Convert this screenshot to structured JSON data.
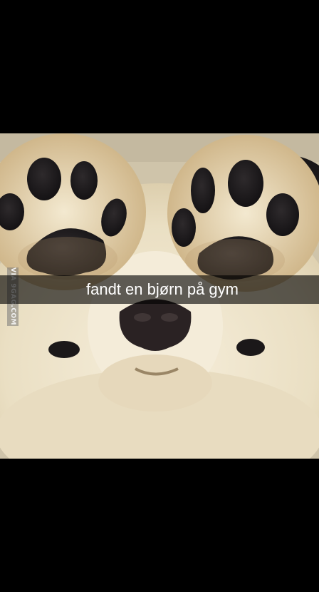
{
  "snap": {
    "caption": "fandt en bjørn på gym",
    "watermark": "VIA 9GAG.COM"
  },
  "image": {
    "subject_icon": "dog-paws-photo"
  },
  "colors": {
    "background": "#000000",
    "fur": "#efe6cf",
    "fur_shadow": "#cdbb94",
    "pad": "#1a1718",
    "nose": "#2a2223",
    "caption_bar": "rgba(0,0,0,0.62)"
  }
}
